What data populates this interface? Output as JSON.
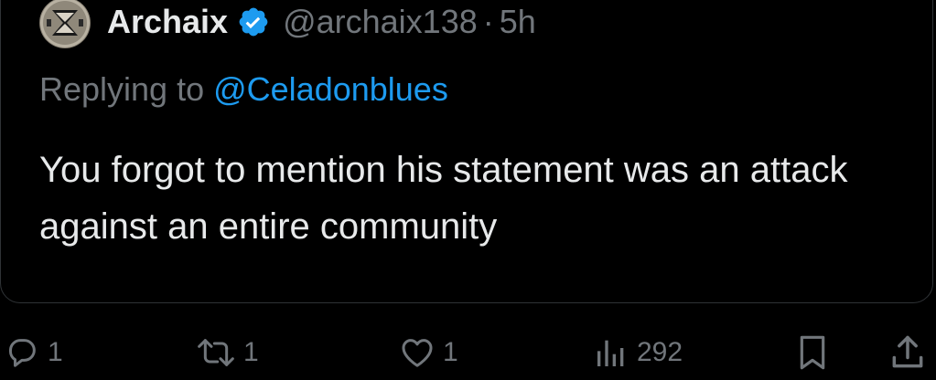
{
  "tweet": {
    "author": {
      "display_name": "Archaix",
      "handle": "@archaix138",
      "verified": true,
      "avatar_icon": "archaix-logo-avatar"
    },
    "separator": "·",
    "time": "5h",
    "reply": {
      "prefix": "Replying to ",
      "mention": "@Celadonblues"
    },
    "text": "You forgot to mention his statement was an attack against an entire community"
  },
  "actions": {
    "replies": {
      "icon": "reply-icon",
      "count": "1"
    },
    "retweets": {
      "icon": "retweet-icon",
      "count": "1"
    },
    "likes": {
      "icon": "heart-icon",
      "count": "1"
    },
    "views": {
      "icon": "views-icon",
      "count": "292"
    },
    "bookmark": {
      "icon": "bookmark-icon"
    },
    "share": {
      "icon": "share-icon"
    }
  },
  "colors": {
    "background": "#000000",
    "text": "#e7e9ea",
    "secondary": "#71767b",
    "accent": "#1d9bf0",
    "border": "#2f3336"
  }
}
